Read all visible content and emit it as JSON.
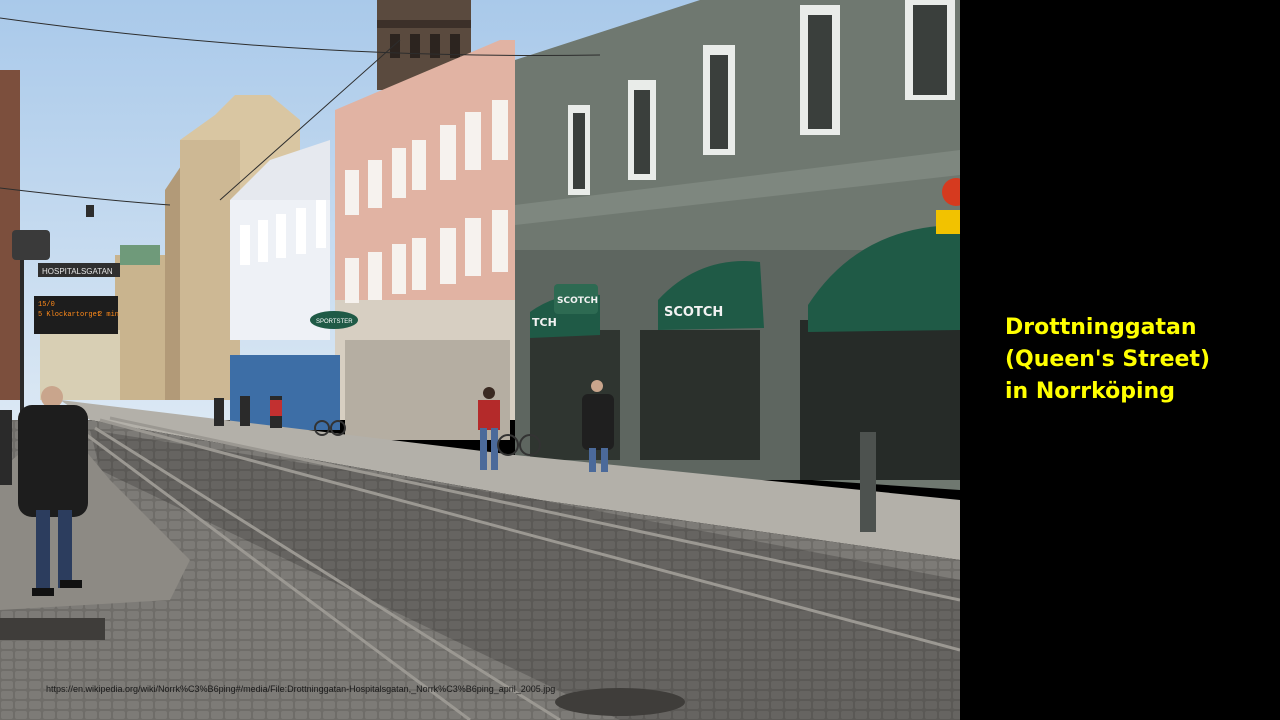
{
  "slide": {
    "caption_lines": [
      "Drottninggatan",
      "(Queen's Street)",
      "in Norrköping"
    ],
    "source_url": "https://en.wikipedia.org/wiki/Norrk%C3%B6ping#/media/File:Drottninggatan-Hospitalsgatan,_Norrk%C3%B6ping_april_2005.jpg"
  },
  "photo": {
    "description_icon": "street-photo",
    "signs": {
      "street_sign": "HOSPITALSGATAN",
      "tram_display_line1": "15/0",
      "tram_display_line2": "5 Klockartorget",
      "tram_display_time": "2 min",
      "shop_name": "SCOTCH",
      "shop_sign_2": "SCOTCH",
      "shop_sign_3": "TCH",
      "hanging_sign": "SCOTCH",
      "oval_sign": "SPORTSTER"
    }
  },
  "colors": {
    "caption": "#ffff00",
    "background": "#000000",
    "awning_green": "#1f5a46"
  }
}
